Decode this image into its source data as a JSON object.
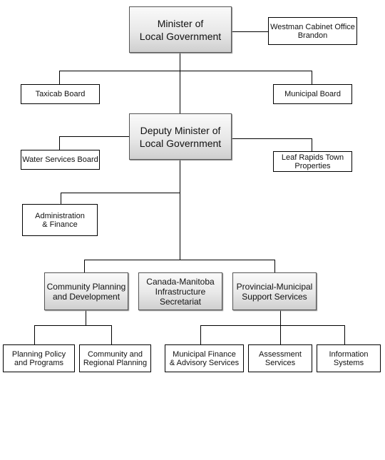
{
  "chart": {
    "minister": "Minister of\nLocal Government",
    "westman": "Westman Cabinet Office\nBrandon",
    "taxicab": "Taxicab Board",
    "municipal_board": "Municipal Board",
    "deputy": "Deputy Minister of\nLocal Government",
    "water": "Water Services Board",
    "leaf_rapids": "Leaf Rapids Town\nProperties",
    "admin": "Administration\n& Finance",
    "community_planning": "Community Planning\nand Development",
    "infrastructure": "Canada-Manitoba\nInfrastructure\nSecretariat",
    "provincial_municipal": "Provincial-Municipal\nSupport Services",
    "planning_policy": "Planning Policy\nand Programs",
    "community_regional": "Community and\nRegional Planning",
    "municipal_finance": "Municipal Finance\n& Advisory Services",
    "assessment": "Assessment\nServices",
    "information": "Information\nSystems"
  }
}
